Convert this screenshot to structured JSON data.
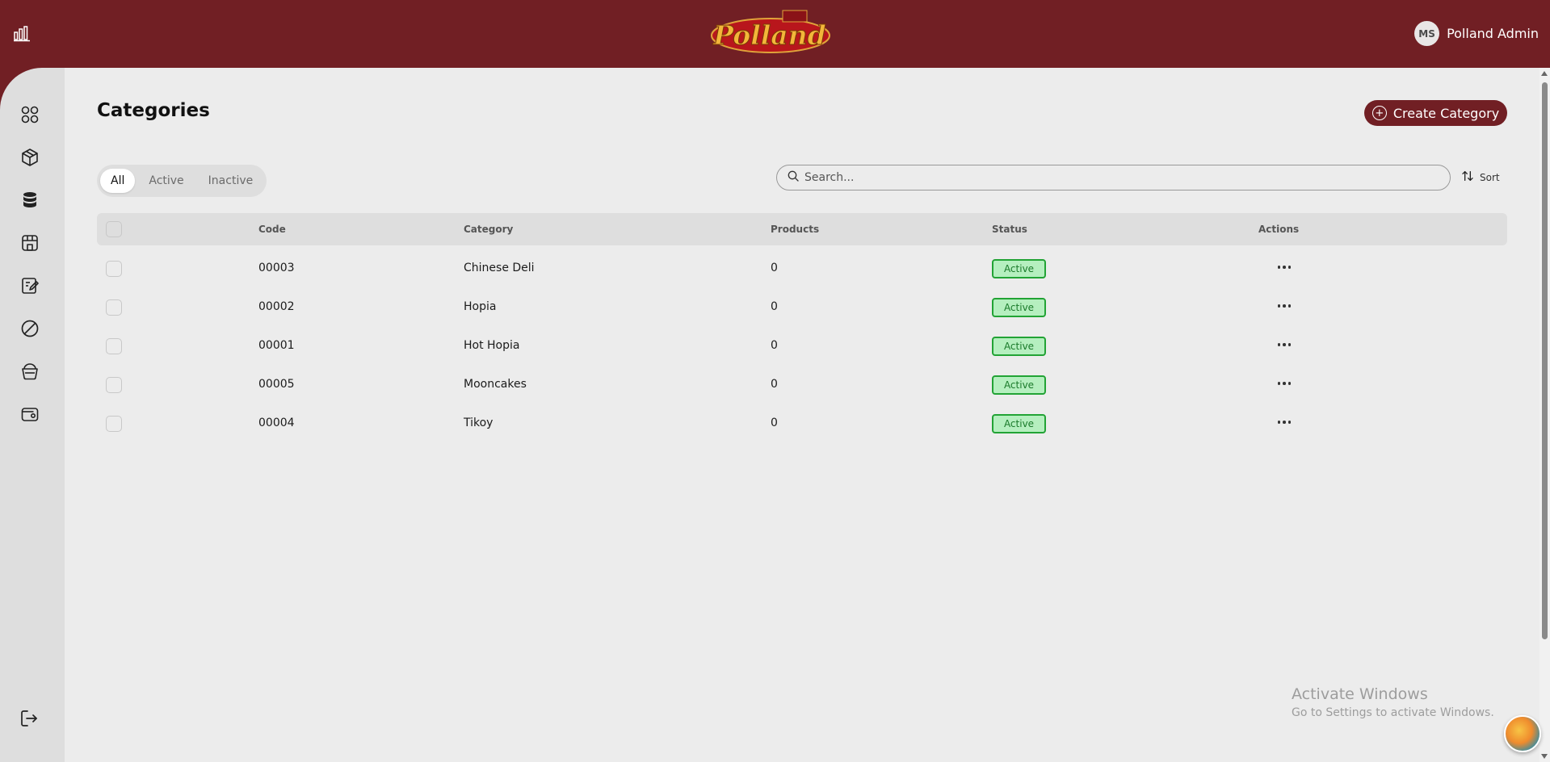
{
  "header": {
    "brand": "Polland",
    "user": {
      "initials": "MS",
      "name": "Polland Admin"
    }
  },
  "sidebar": {
    "items": [
      {
        "icon": "grid-icon"
      },
      {
        "icon": "package-icon"
      },
      {
        "icon": "database-icon"
      },
      {
        "icon": "store-icon"
      },
      {
        "icon": "edit-icon"
      },
      {
        "icon": "ban-icon"
      },
      {
        "icon": "basket-icon"
      },
      {
        "icon": "wallet-icon"
      }
    ],
    "logout_icon": "logout-icon"
  },
  "page": {
    "title": "Categories",
    "create_label": "Create Category"
  },
  "filters": {
    "tabs": [
      "All",
      "Active",
      "Inactive"
    ],
    "selected": "All"
  },
  "search": {
    "placeholder": "Search...",
    "value": ""
  },
  "sort_label": "Sort",
  "table": {
    "columns": [
      "Code",
      "Category",
      "Products",
      "Status",
      "Actions"
    ],
    "rows": [
      {
        "code": "00003",
        "category": "Chinese Deli",
        "products": "0",
        "status": "Active"
      },
      {
        "code": "00002",
        "category": "Hopia",
        "products": "0",
        "status": "Active"
      },
      {
        "code": "00001",
        "category": "Hot Hopia",
        "products": "0",
        "status": "Active"
      },
      {
        "code": "00005",
        "category": "Mooncakes",
        "products": "0",
        "status": "Active"
      },
      {
        "code": "00004",
        "category": "Tikoy",
        "products": "0",
        "status": "Active"
      }
    ]
  },
  "watermark": {
    "line1": "Activate Windows",
    "line2": "Go to Settings to activate Windows."
  },
  "colors": {
    "brand": "#711f24",
    "status_active_border": "#22a335",
    "status_active_bg": "#b5efbf"
  }
}
